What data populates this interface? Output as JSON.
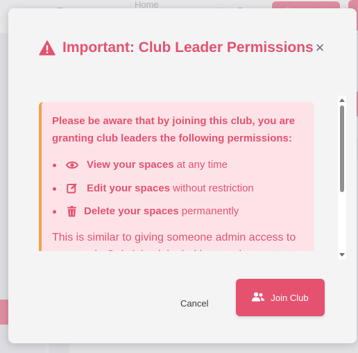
{
  "background": {
    "nav_items": [
      "Tags",
      "Home Page",
      "Next Post"
    ],
    "dashboard_label": "Dashboard",
    "primary_color": "#e4526f"
  },
  "modal": {
    "title": "Important: Club Leader Permissions",
    "close_label": "×",
    "warning_icon": "warning-triangle-icon",
    "intro": "Please be aware that by joining this club, you are granting club leaders the following permissions:",
    "permissions": [
      {
        "icon": "eye-icon",
        "strong": "View your spaces",
        "rest": "at any time"
      },
      {
        "icon": "edit-icon",
        "strong": "Edit your spaces",
        "rest": "without restriction"
      },
      {
        "icon": "trash-icon",
        "strong": "Delete your spaces",
        "rest": "permanently"
      }
    ],
    "note": "This is similar to giving someone admin access to your work. Only join clubs led by people you trust.",
    "cancel_label": "Cancel",
    "join_label": "Join Club",
    "join_icon": "users-icon"
  }
}
